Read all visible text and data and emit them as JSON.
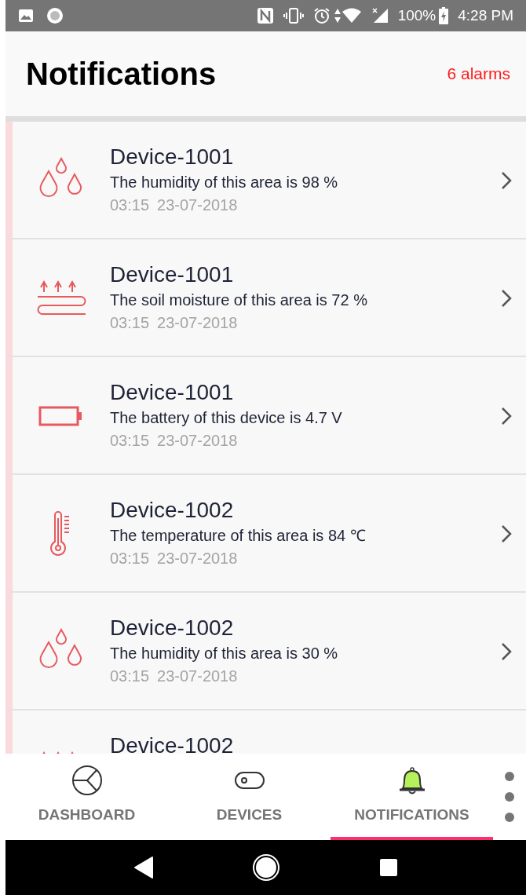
{
  "status_bar": {
    "battery": "100%",
    "time": "4:28 PM"
  },
  "header": {
    "title": "Notifications",
    "alarm_count": "6 alarms"
  },
  "notifications": [
    {
      "kind": "humidity",
      "device": "Device-1001",
      "message": "The humidity of this area is 98 %",
      "time": "03:15",
      "date": "23-07-2018"
    },
    {
      "kind": "soil",
      "device": "Device-1001",
      "message": "The soil moisture of this area is 72 %",
      "time": "03:15",
      "date": "23-07-2018"
    },
    {
      "kind": "battery",
      "device": "Device-1001",
      "message": "The battery of this device is 4.7 V",
      "time": "03:15",
      "date": "23-07-2018"
    },
    {
      "kind": "temperature",
      "device": "Device-1002",
      "message": "The temperature of this area is 84 ℃",
      "time": "03:15",
      "date": "23-07-2018"
    },
    {
      "kind": "humidity",
      "device": "Device-1002",
      "message": "The humidity of this area is 30 %",
      "time": "03:15",
      "date": "23-07-2018"
    },
    {
      "kind": "soil",
      "device": "Device-1002"
    }
  ],
  "tabs": [
    {
      "kind": "dashboard",
      "label": "DASHBOARD",
      "selected": false
    },
    {
      "kind": "devices",
      "label": "DEVICES",
      "selected": false
    },
    {
      "kind": "notifications",
      "label": "NOTIFICATIONS",
      "selected": true
    }
  ]
}
